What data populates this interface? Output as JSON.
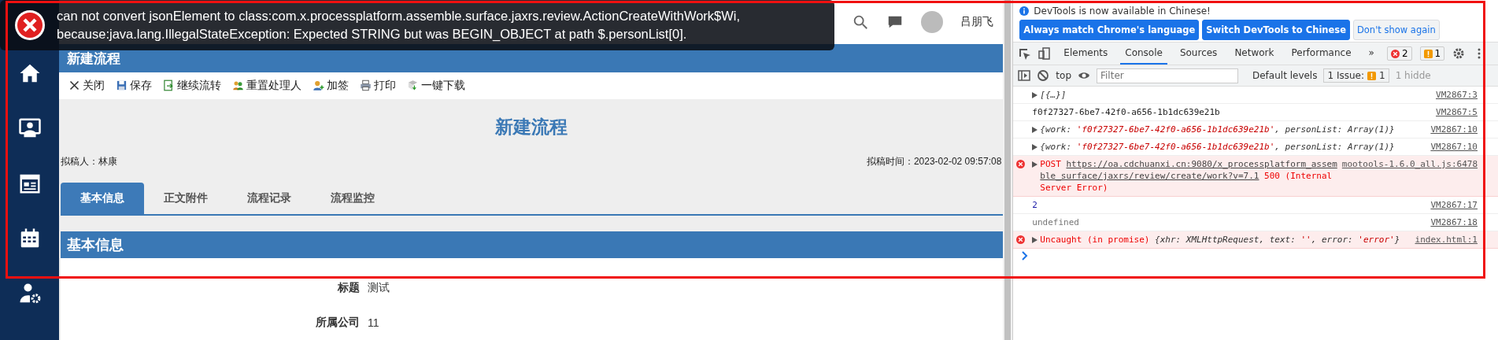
{
  "toast": {
    "lines": [
      "can not convert jsonElement to class:com.x.processplatform.assemble.surface.jaxrs.review.ActionCreateWithWork$Wi,",
      "because:java.lang.IllegalStateException: Expected STRING but was BEGIN_OBJECT at path $.personList[0]."
    ]
  },
  "header": {
    "user_name": "吕朋飞"
  },
  "page_bar": {
    "title": "新建流程"
  },
  "toolbar": [
    {
      "label": "关闭",
      "kind": "close"
    },
    {
      "label": "保存",
      "kind": "save"
    },
    {
      "label": "继续流转",
      "kind": "forward"
    },
    {
      "label": "重置处理人",
      "kind": "people"
    },
    {
      "label": "加签",
      "kind": "add-person"
    },
    {
      "label": "打印",
      "kind": "print"
    },
    {
      "label": "一键下载",
      "kind": "download"
    }
  ],
  "document": {
    "title": "新建流程",
    "drafter": "拟稿人：林康",
    "draft_time": "拟稿时间：2023-02-02 09:57:08"
  },
  "tabs": [
    {
      "label": "基本信息",
      "selected": true
    },
    {
      "label": "正文附件",
      "selected": false
    },
    {
      "label": "流程记录",
      "selected": false
    },
    {
      "label": "流程监控",
      "selected": false
    }
  ],
  "section": {
    "title": "基本信息",
    "fields": [
      {
        "label": "标题",
        "value": "测试"
      },
      {
        "label": "所属公司",
        "value": "11"
      }
    ]
  },
  "devtools": {
    "banner": {
      "message": "DevTools is now available in Chinese!",
      "buttons": [
        {
          "label": "Always match Chrome's language",
          "kind": "primary"
        },
        {
          "label": "Switch DevTools to Chinese",
          "kind": "primary"
        },
        {
          "label": "Don't show again",
          "kind": "secondary"
        }
      ]
    },
    "tabs": [
      {
        "label": "Elements",
        "selected": false
      },
      {
        "label": "Console",
        "selected": true
      },
      {
        "label": "Sources",
        "selected": false
      },
      {
        "label": "Network",
        "selected": false
      },
      {
        "label": "Performance",
        "selected": false
      }
    ],
    "more_tabs": "»",
    "error_count": "2",
    "warning_count": "1",
    "console_toolbar": {
      "context": "top",
      "filter_placeholder": "Filter",
      "levels": "Default levels",
      "issues_label": "1 Issue:",
      "issues_count": "1",
      "hidden": "1 hidde"
    },
    "messages": [
      {
        "kind": "log",
        "expandable": true,
        "parts": [
          {
            "kind": "preview",
            "text": "[{…}]"
          }
        ],
        "source": "VM2867:3"
      },
      {
        "kind": "log",
        "expandable": false,
        "parts": [
          {
            "kind": "plain",
            "text": "f0f27327-6be7-42f0-a656-1b1dc639e21b"
          }
        ],
        "source": "VM2867:5"
      },
      {
        "kind": "log",
        "expandable": true,
        "parts": [
          {
            "kind": "preview",
            "text": "{work: "
          },
          {
            "kind": "string",
            "text": "'f0f27327-6be7-42f0-a656-1b1dc639e21b'"
          },
          {
            "kind": "preview",
            "text": ", personList: Array(1)}"
          }
        ],
        "source": "VM2867:10"
      },
      {
        "kind": "log",
        "expandable": true,
        "parts": [
          {
            "kind": "preview",
            "text": "{work: "
          },
          {
            "kind": "string",
            "text": "'f0f27327-6be7-42f0-a656-1b1dc639e21b'"
          },
          {
            "kind": "preview",
            "text": ", personList: Array(1)}"
          }
        ],
        "source": "VM2867:10"
      },
      {
        "kind": "error",
        "expandable": true,
        "parts": [
          {
            "kind": "error-text",
            "text": "POST "
          },
          {
            "kind": "link",
            "text": "https://oa.cdchuanxi.cn:9080/x_processplatform_assemble_surface/jaxrs/review/create/work?v=7.1"
          },
          {
            "kind": "error-text",
            "text": " 500 (Internal Server Error)"
          }
        ],
        "source": "mootools-1.6.0_all.js:6478"
      },
      {
        "kind": "log",
        "expandable": false,
        "parts": [
          {
            "kind": "number",
            "text": "2"
          }
        ],
        "source": "VM2867:17"
      },
      {
        "kind": "log",
        "expandable": false,
        "parts": [
          {
            "kind": "undefined",
            "text": "undefined"
          }
        ],
        "source": "VM2867:18"
      },
      {
        "kind": "error",
        "expandable": true,
        "parts": [
          {
            "kind": "error-text",
            "text": "Uncaught (in promise) "
          },
          {
            "kind": "preview",
            "text": "{xhr: XMLHttpRequest, text: "
          },
          {
            "kind": "string",
            "text": "''"
          },
          {
            "kind": "preview",
            "text": ", error: "
          },
          {
            "kind": "string",
            "text": "'error'"
          },
          {
            "kind": "preview",
            "text": "}"
          }
        ],
        "source": "index.html:1"
      }
    ]
  }
}
